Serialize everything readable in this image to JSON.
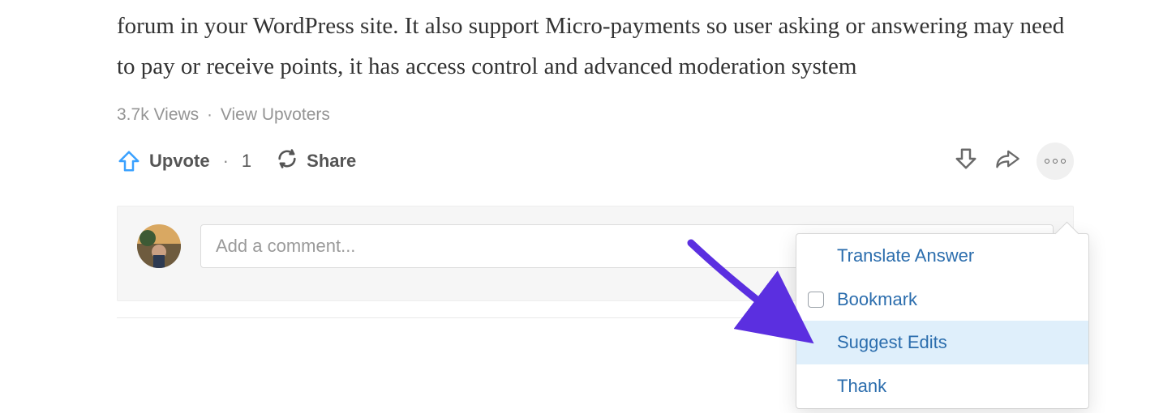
{
  "answer": {
    "body": "forum in your WordPress site. It also support Micro-payments so user asking or answering may need to pay or receive points, it has access control and advanced moderation system"
  },
  "meta": {
    "views": "3.7k Views",
    "upvoters_link": "View Upvoters"
  },
  "actions": {
    "upvote_label": "Upvote",
    "upvote_count": "1",
    "share_label": "Share"
  },
  "comment": {
    "placeholder": "Add a comment..."
  },
  "menu": {
    "items": [
      {
        "label": "Translate Answer"
      },
      {
        "label": "Bookmark",
        "checkbox": true
      },
      {
        "label": "Suggest Edits",
        "highlight": true
      },
      {
        "label": "Thank"
      }
    ]
  },
  "colors": {
    "link_blue": "#2b6dad",
    "upvote_blue": "#3aa1ff",
    "arrow_purple": "#5b2fe0"
  }
}
